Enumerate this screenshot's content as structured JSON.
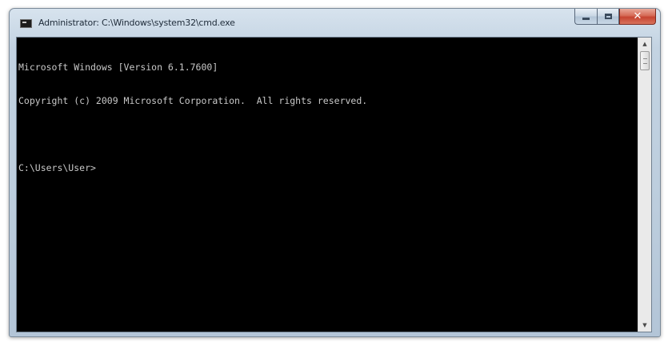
{
  "window": {
    "title": "Administrator: C:\\Windows\\system32\\cmd.exe"
  },
  "caption_buttons": {
    "minimize_icon": "minimize-icon",
    "maximize_icon": "maximize-icon",
    "close_icon": "close-icon",
    "close_glyph": "✕"
  },
  "console": {
    "lines": [
      "Microsoft Windows [Version 6.1.7600]",
      "Copyright (c) 2009 Microsoft Corporation.  All rights reserved.",
      "",
      "C:\\Users\\User>"
    ],
    "text_color": "#c0c0c0",
    "background_color": "#000000"
  },
  "scrollbar": {
    "up_arrow": "▲",
    "down_arrow": "▼"
  },
  "colors": {
    "frame": "#bccddd",
    "close_button": "#c64431"
  }
}
